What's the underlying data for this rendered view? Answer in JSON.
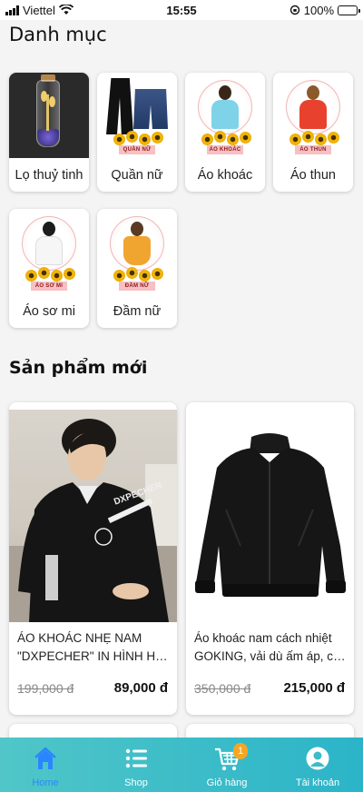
{
  "status_bar": {
    "carrier": "Viettel",
    "time": "15:55",
    "battery": "100%"
  },
  "categories_title": "Danh mục",
  "categories": [
    {
      "label": "Lọ thuỷ tinh",
      "image": "glass-jar-image"
    },
    {
      "label": "Quần nữ",
      "tag": "QUẦN NỮ",
      "image": "women-pants-image"
    },
    {
      "label": "Áo khoác",
      "tag": "ÁO KHOÁC",
      "image": "jacket-model-image"
    },
    {
      "label": "Áo thun",
      "tag": "ÁO THUN",
      "image": "tshirt-model-image"
    },
    {
      "label": "Áo sơ mi",
      "tag": "ÁO SƠ MI",
      "image": "shirt-model-image"
    },
    {
      "label": "Đầm nữ",
      "tag": "ĐẦM NỮ",
      "image": "dress-model-image"
    }
  ],
  "new_products_title": "Sản phẩm mới",
  "products": [
    {
      "name_line1": "ÁO KHOÁC NHẸ NAM",
      "name_line2": "\"DXPECHER\" IN HÌNH HỌA...",
      "old_price": "199,000 đ",
      "price": "89,000 đ",
      "image": "man-black-jacket-photo",
      "print_text": "DXPECHER"
    },
    {
      "name_line1": "Áo khoác nam cách nhiệt",
      "name_line2": "GOKING, vải dù ấm áp, cản...",
      "old_price": "350,000 đ",
      "price": "215,000 đ",
      "image": "black-bomber-jacket-photo"
    }
  ],
  "tabs": [
    {
      "label": "Home",
      "icon": "home-icon",
      "active": true
    },
    {
      "label": "Shop",
      "icon": "list-icon",
      "active": false
    },
    {
      "label": "Giỏ hàng",
      "icon": "cart-icon",
      "active": false,
      "badge": "1"
    },
    {
      "label": "Tài khoản",
      "icon": "user-icon",
      "active": false
    }
  ],
  "colors": {
    "tab_gradient_start": "#50c6c8",
    "tab_gradient_end": "#2bb4c8",
    "active_tab": "#2a86ff",
    "badge": "#f5a623"
  }
}
